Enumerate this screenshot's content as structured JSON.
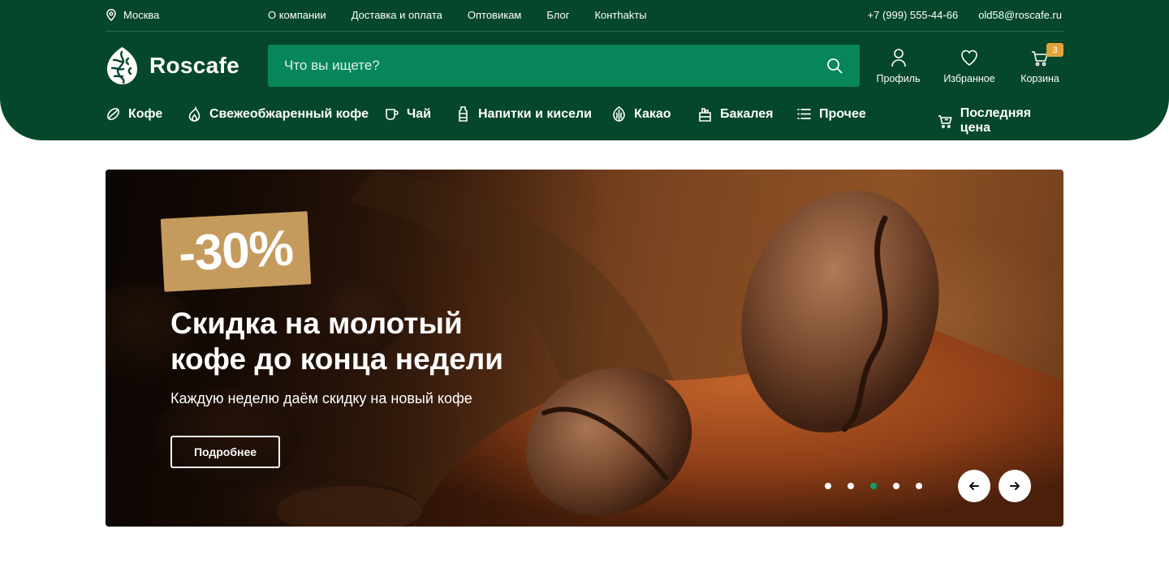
{
  "topbar": {
    "city": "Москва",
    "nav": [
      "О компании",
      "Доставка и оплата",
      "Оптовикам",
      "Блог",
      "Контhakты"
    ],
    "phone": "+7 (999) 555-44-66",
    "email": "old58@roscafe.ru"
  },
  "logo": {
    "text": "Roscafe"
  },
  "search": {
    "placeholder": "Что вы ищете?"
  },
  "actions": {
    "profile": "Профиль",
    "favorites": "Избранное",
    "cart": "Корзина",
    "cart_count": "3"
  },
  "categories": [
    {
      "label": "Кофе",
      "icon": "coffee-bean-icon"
    },
    {
      "label": "Свежеобжаренный кофе",
      "icon": "flame-icon"
    },
    {
      "label": "Чай",
      "icon": "tea-cup-icon"
    },
    {
      "label": "Напитки и кисели",
      "icon": "bottle-icon"
    },
    {
      "label": "Какао",
      "icon": "cocoa-icon"
    },
    {
      "label": "Бакалея",
      "icon": "grocery-icon"
    },
    {
      "label": "Прочее",
      "icon": "list-icon"
    },
    {
      "label": "Последняя цена",
      "icon": "cart-icon"
    }
  ],
  "banner": {
    "discount": "-30%",
    "title": "Скидка на молотый кофе до конца недели",
    "subtitle": "Каждую неделю даём скидку на новый кофе",
    "button": "Подробнее",
    "slides_total": 5,
    "active_slide": 3
  },
  "colors": {
    "header_bg": "#04472a",
    "search_bg": "#07865a",
    "badge": "#e0a43b",
    "discount_bg": "#c59a5d",
    "active_dot": "#0aa06a"
  }
}
